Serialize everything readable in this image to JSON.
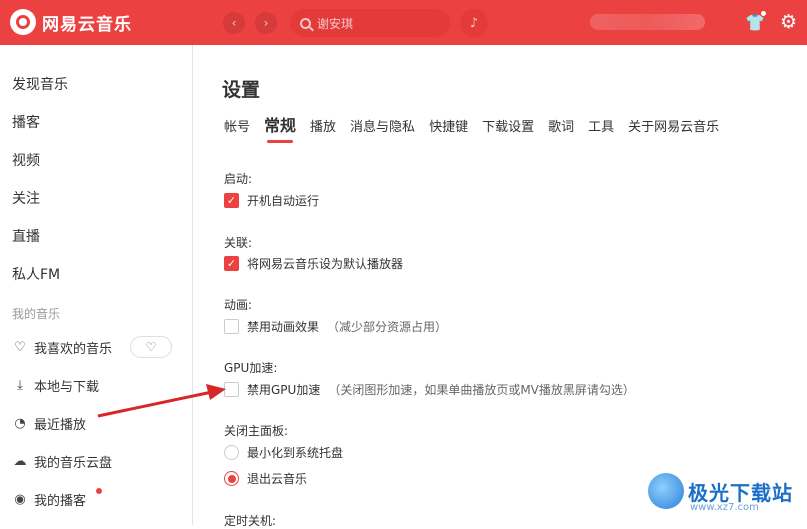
{
  "app": {
    "name": "网易云音乐"
  },
  "topbar": {
    "back_icon": "‹",
    "forward_icon": "›",
    "search_placeholder": "谢安琪",
    "mic_icon": "♪",
    "shirt_icon": "👕",
    "settings_icon": "⚙"
  },
  "sidebar": {
    "items": [
      {
        "label": "发现音乐"
      },
      {
        "label": "播客"
      },
      {
        "label": "视频"
      },
      {
        "label": "关注"
      },
      {
        "label": "直播"
      },
      {
        "label": "私人FM"
      }
    ],
    "section_title": "我的音乐",
    "my_music": [
      {
        "label": "我喜欢的音乐",
        "icon": "♡"
      },
      {
        "label": "本地与下载",
        "icon": "⤓"
      },
      {
        "label": "最近播放",
        "icon": "◔"
      },
      {
        "label": "我的音乐云盘",
        "icon": "☁"
      },
      {
        "label": "我的播客",
        "icon": "◉"
      }
    ],
    "heart_mode_icon": "♡"
  },
  "main": {
    "title": "设置",
    "tabs": [
      {
        "label": "帐号"
      },
      {
        "label": "常规"
      },
      {
        "label": "播放"
      },
      {
        "label": "消息与隐私"
      },
      {
        "label": "快捷键"
      },
      {
        "label": "下载设置"
      },
      {
        "label": "歌词"
      },
      {
        "label": "工具"
      },
      {
        "label": "关于网易云音乐"
      }
    ],
    "sections": {
      "startup": {
        "label": "启动:",
        "option": "开机自动运行",
        "checked": true
      },
      "association": {
        "label": "关联:",
        "option": "将网易云音乐设为默认播放器",
        "checked": true
      },
      "animation": {
        "label": "动画:",
        "option": "禁用动画效果",
        "note": "（减少部分资源占用）",
        "checked": false
      },
      "gpu": {
        "label": "GPU加速:",
        "option": "禁用GPU加速",
        "note": "（关闭图形加速，如果单曲播放页或MV播放黑屏请勾选）",
        "checked": false
      },
      "close_panel": {
        "label": "关闭主面板:",
        "options": [
          "最小化到系统托盘",
          "退出云音乐"
        ],
        "selected": "退出云音乐"
      },
      "timer": {
        "label": "定时关机:"
      }
    }
  },
  "watermark": {
    "text": "极光下载站",
    "url": "www.xz7.com"
  },
  "colors": {
    "accent": "#ec4141",
    "annotation_arrow": "#d9262a"
  }
}
